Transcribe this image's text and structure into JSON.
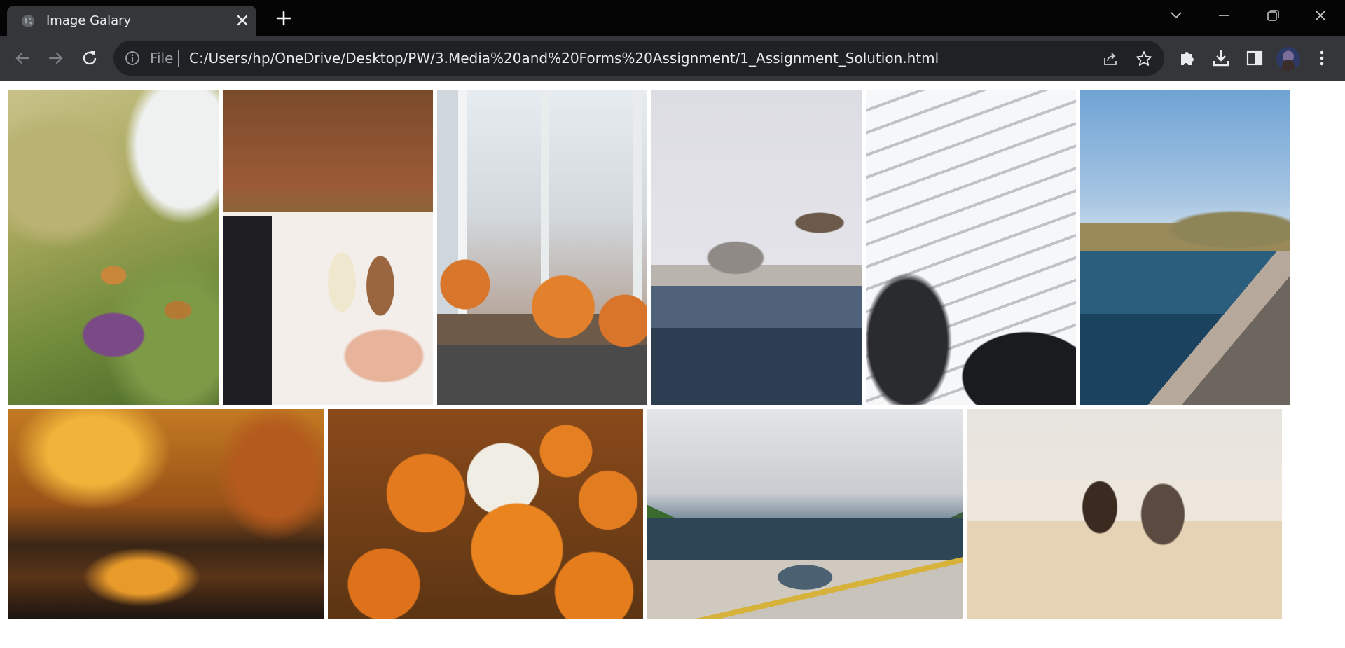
{
  "browser": {
    "tab_title": "Image Galary",
    "omnibox_file": "File",
    "url": "C:/Users/hp/OneDrive/Desktop/PW/3.Media%20and%20Forms%20Assignment/1_Assignment_Solution.html"
  },
  "icons": {
    "favicon": "globe-icon",
    "tab_close": "close-icon",
    "new_tab": "plus-icon",
    "tab_search": "chevron-down-icon",
    "minimize": "minimize-icon",
    "restore": "restore-icon",
    "close_window": "close-icon",
    "back": "back-arrow-icon",
    "forward": "forward-arrow-icon",
    "reload": "reload-icon",
    "site_info": "info-icon",
    "share": "share-icon",
    "bookmark": "star-icon",
    "extensions": "puzzle-icon",
    "downloads": "download-icon",
    "side_panel": "side-panel-icon",
    "profile": "avatar",
    "menu": "kebab-menu-icon"
  },
  "colors": {
    "tabbar_bg": "#050505",
    "toolbar_bg": "#35363a",
    "omnibox_bg": "#202124",
    "text_light": "#e8eaed",
    "text_muted": "#9aa0a6",
    "page_bg": "#ffffff"
  },
  "gallery": {
    "images": [
      {
        "subject": "butterflies-on-flower"
      },
      {
        "subject": "iced-coffee-laptop"
      },
      {
        "subject": "pumpkins-on-windowsill"
      },
      {
        "subject": "seagulls-over-water"
      },
      {
        "subject": "white-architecture-interior"
      },
      {
        "subject": "coastal-town-beach"
      },
      {
        "subject": "autumn-forest-lake"
      },
      {
        "subject": "pumpkin-patch"
      },
      {
        "subject": "fjord-with-picnic-table"
      },
      {
        "subject": "horse-riders-on-beach"
      }
    ]
  }
}
